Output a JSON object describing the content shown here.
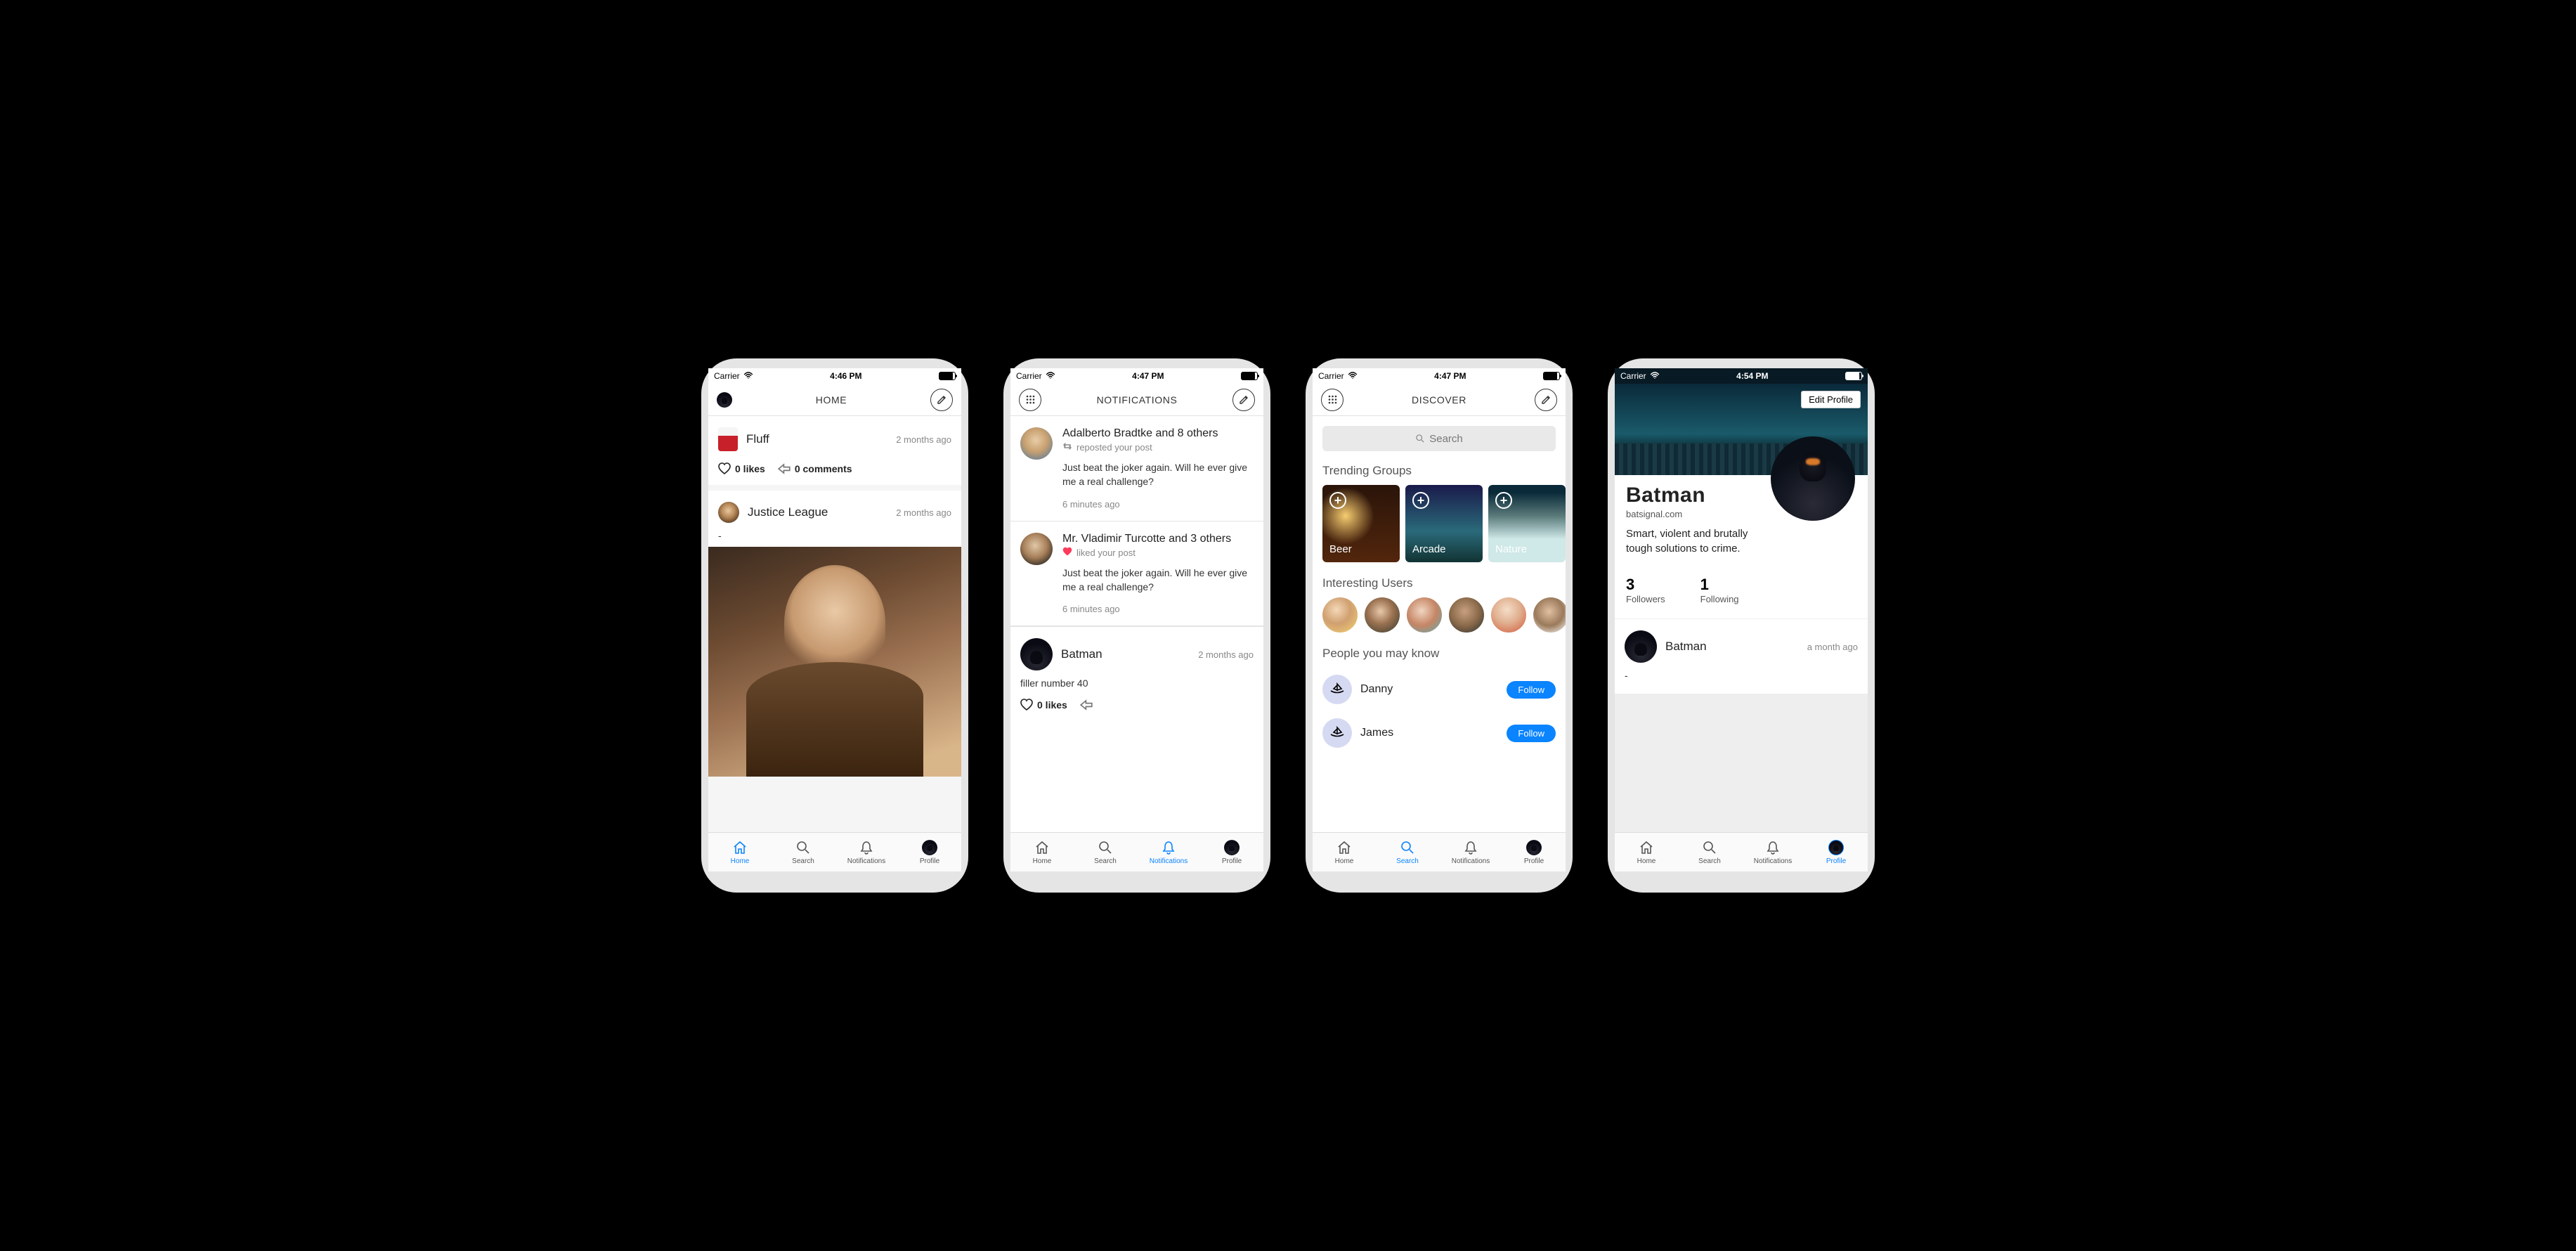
{
  "screens": [
    {
      "status": {
        "carrier": "Carrier",
        "time": "4:46 PM"
      },
      "header": {
        "title": "HOME",
        "left": "avatar"
      },
      "feed": [
        {
          "name": "Fluff",
          "time": "2 months ago",
          "likes": "0 likes",
          "comments": "0 comments"
        },
        {
          "name": "Justice League",
          "time": "2 months ago",
          "body": "-"
        }
      ],
      "tabs": {
        "active": "Home",
        "home": "Home",
        "search": "Search",
        "notifications": "Notifications",
        "profile": "Profile"
      }
    },
    {
      "status": {
        "carrier": "Carrier",
        "time": "4:47 PM"
      },
      "header": {
        "title": "NOTIFICATIONS"
      },
      "notifs": [
        {
          "title": "Adalberto Bradtke and 8 others",
          "sub": "reposted your post",
          "kind": "repost",
          "text": "Just beat the joker again. Will he ever give me a real challenge?",
          "time": "6 minutes ago"
        },
        {
          "title": "Mr. Vladimir Turcotte and 3 others",
          "sub": "liked your post",
          "kind": "like",
          "text": "Just beat the joker again. Will he ever give me a real challenge?",
          "time": "6 minutes ago"
        }
      ],
      "feed_post": {
        "name": "Batman",
        "time": "2 months ago",
        "body": "filler number 40",
        "likes": "0 likes"
      },
      "tabs": {
        "active": "Notifications",
        "home": "Home",
        "search": "Search",
        "notifications": "Notifications",
        "profile": "Profile"
      }
    },
    {
      "status": {
        "carrier": "Carrier",
        "time": "4:47 PM"
      },
      "header": {
        "title": "DISCOVER"
      },
      "search": {
        "placeholder": "Search"
      },
      "sections": {
        "trending": "Trending Groups",
        "users": "Interesting Users",
        "pymk": "People you may know"
      },
      "groups": [
        {
          "label": "Beer"
        },
        {
          "label": "Arcade"
        },
        {
          "label": "Nature"
        }
      ],
      "pymk": [
        {
          "name": "Danny",
          "action": "Follow"
        },
        {
          "name": "James",
          "action": "Follow"
        }
      ],
      "tabs": {
        "active": "Search",
        "home": "Home",
        "search": "Search",
        "notifications": "Notifications",
        "profile": "Profile"
      }
    },
    {
      "status": {
        "carrier": "Carrier",
        "time": "4:54 PM"
      },
      "edit": "Edit Profile",
      "profile": {
        "name": "Batman",
        "site": "batsignal.com",
        "bio": "Smart, violent and brutally tough solutions to crime.",
        "followers_n": "3",
        "followers_l": "Followers",
        "following_n": "1",
        "following_l": "Following"
      },
      "post": {
        "name": "Batman",
        "time": "a month ago",
        "body": "-"
      },
      "tabs": {
        "active": "Profile",
        "home": "Home",
        "search": "Search",
        "notifications": "Notifications",
        "profile": "Profile"
      }
    }
  ]
}
